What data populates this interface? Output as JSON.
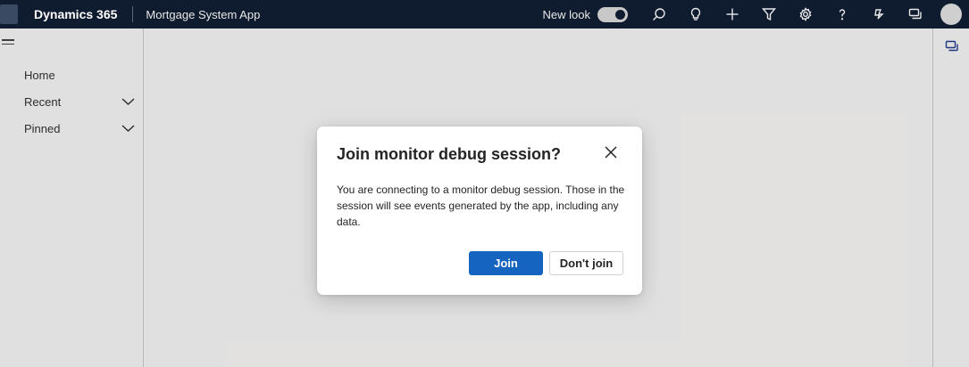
{
  "topbar": {
    "brand": "Dynamics 365",
    "app_name": "Mortgage System App",
    "new_look_label": "New look",
    "new_look_on": true,
    "icons": [
      "search-icon",
      "lightbulb-icon",
      "plus-icon",
      "filter-icon",
      "gear-icon",
      "help-icon",
      "copilot-icon",
      "chat-icon"
    ]
  },
  "sidebar": {
    "items": [
      {
        "label": "Home",
        "expandable": false
      },
      {
        "label": "Recent",
        "expandable": true
      },
      {
        "label": "Pinned",
        "expandable": true
      }
    ]
  },
  "dialog": {
    "title": "Join monitor debug session?",
    "body": "You are connecting to a monitor debug session. Those in the session will see events generated by the app, including any data.",
    "primary_label": "Join",
    "secondary_label": "Don't join"
  },
  "colors": {
    "topbar_bg": "#0f1b2e",
    "primary_button": "#1565c0"
  }
}
